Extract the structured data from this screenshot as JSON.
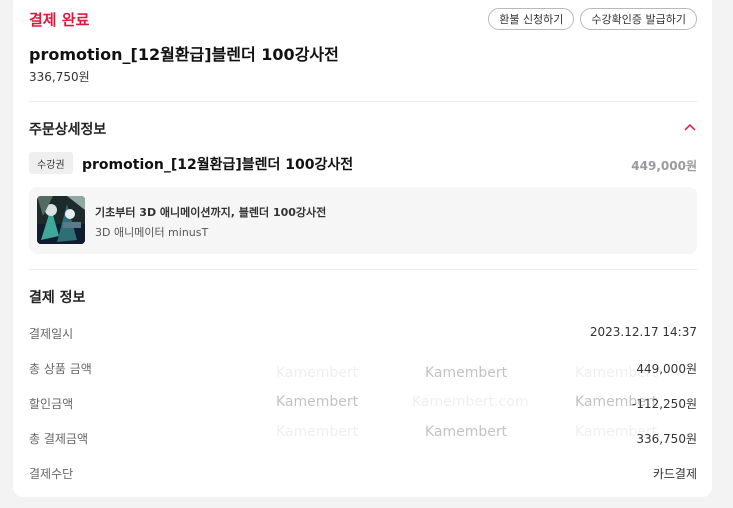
{
  "header": {
    "status": "결제 완료",
    "buttons": [
      "환불 신청하기",
      "수강확인증 발급하기"
    ],
    "product_title": "promotion_[12월환급]블렌더 100강사전",
    "product_price": "336,750원"
  },
  "order_detail": {
    "section_title": "주문상세정보",
    "badge": "수강권",
    "item_name": "promotion_[12월환급]블렌더 100강사전",
    "item_price": "449,000원",
    "course": {
      "title": "기초부터 3D 애니메이션까지, 블렌더 100강사전",
      "author": "3D 애니메이터 minusT"
    }
  },
  "payment": {
    "section_title": "결제 정보",
    "rows": [
      {
        "label": "결제일시",
        "value": "2023.12.17 14:37"
      },
      {
        "label": "총 상품 금액",
        "value": "449,000원"
      },
      {
        "label": "할인금액",
        "value": "-112,250원"
      },
      {
        "label": "총 결제금액",
        "value": "336,750원"
      },
      {
        "label": "결제수단",
        "value": "카드결제"
      }
    ]
  },
  "watermark": {
    "text": "Kamembert",
    "domain": "Kamembert.com"
  },
  "colors": {
    "accent": "#e0173c",
    "card": "#ffffff",
    "background": "#f3f3f4"
  }
}
